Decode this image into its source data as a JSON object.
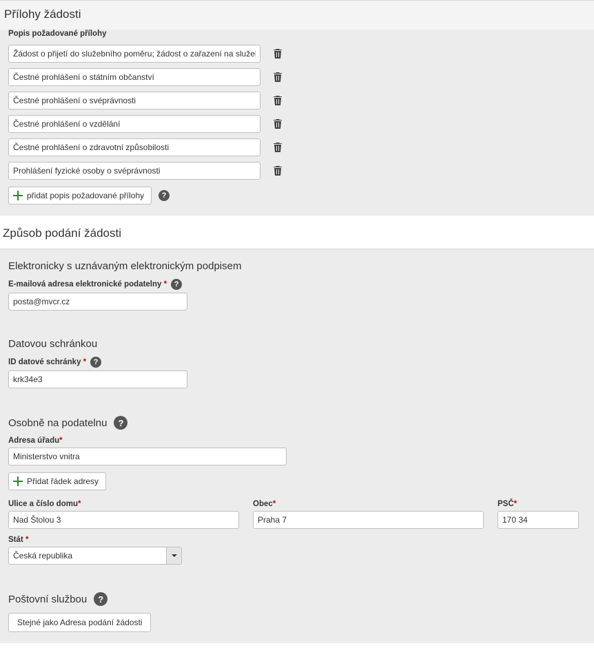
{
  "attachments": {
    "title": "Přílohy žádosti",
    "list_label": "Popis požadované přílohy",
    "items": [
      {
        "value": "Žádost o přijetí do služebního poměru; žádost o zařazení na služební místo"
      },
      {
        "value": "Čestné prohlášení o státním občanství"
      },
      {
        "value": "Čestné prohlášení o svéprávnosti"
      },
      {
        "value": "Čestné prohlášení o vzdělání"
      },
      {
        "value": "Čestné prohlášení o zdravotní způsobilosti"
      },
      {
        "value": "Prohlášení fyzické osoby o svéprávnosti"
      }
    ],
    "add_label": "přidat popis požadované přílohy"
  },
  "submission": {
    "title": "Způsob podání žádosti",
    "electronic": {
      "title": "Elektronicky s uznávaným elektronickým podpisem",
      "email_label": "E-mailová adresa elektronické podatelny",
      "email_value": "posta@mvcr.cz"
    },
    "databox": {
      "title": "Datovou schránkou",
      "id_label": "ID datové schránky",
      "id_value": "krk34e3"
    },
    "inperson": {
      "title": "Osobně na podatelnu",
      "office_label": "Adresa úřadu",
      "office_value": "Ministerstvo vnitra",
      "add_line_label": "Přidat řádek adresy",
      "street_label": "Ulice a číslo domu",
      "street_value": "Nad Štolou 3",
      "city_label": "Obec",
      "city_value": "Praha 7",
      "zip_label": "PSČ",
      "zip_value": "170 34",
      "state_label": "Stát",
      "state_value": "Česká republika"
    },
    "postal": {
      "title": "Poštovní službou",
      "same_as_label": "Stejné jako Adresa podání žádosti"
    }
  },
  "glyphs": {
    "help": "?"
  }
}
